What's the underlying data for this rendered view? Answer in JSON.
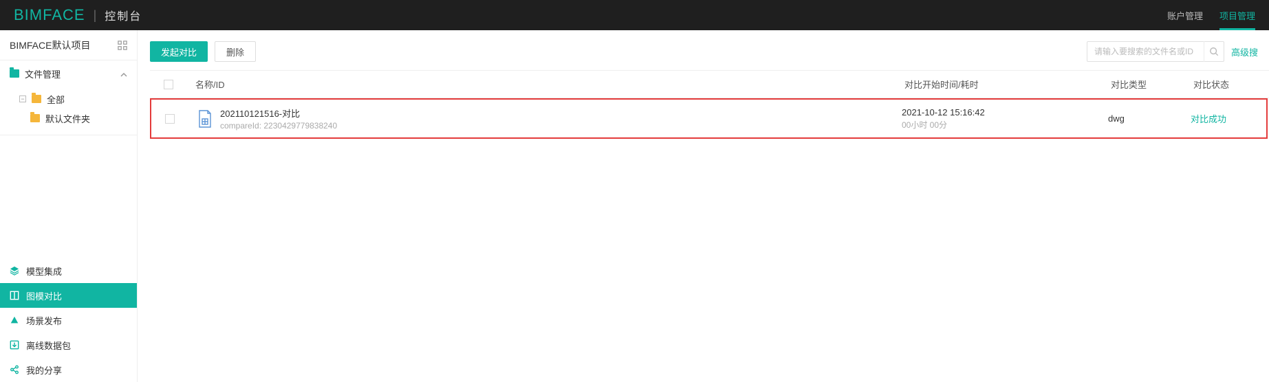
{
  "topbar": {
    "logo": "BIMFACE",
    "logo_suffix": "控制台",
    "nav": {
      "account": "账户管理",
      "project": "项目管理"
    }
  },
  "sidebar": {
    "project_title": "BIMFACE默认项目",
    "tree": {
      "file_mgmt": "文件管理",
      "all": "全部",
      "default_folder": "默认文件夹"
    },
    "nav_items": {
      "model_integrate": "模型集成",
      "compare": "图模对比",
      "scene_publish": "场景发布",
      "offline_package": "离线数据包",
      "my_share": "我的分享"
    }
  },
  "toolbar": {
    "start_compare": "发起对比",
    "delete": "删除",
    "search_placeholder": "请输入要搜索的文件名或ID",
    "advanced": "高级搜"
  },
  "table": {
    "headers": {
      "name": "名称/ID",
      "time": "对比开始时间/耗时",
      "type": "对比类型",
      "status": "对比状态"
    },
    "row0": {
      "title": "202110121516-对比",
      "compare_id_label": "compareId:",
      "compare_id": "2230429779838240",
      "time": "2021-10-12 15:16:42",
      "duration": "00小时 00分",
      "type": "dwg",
      "status": "对比成功"
    }
  }
}
